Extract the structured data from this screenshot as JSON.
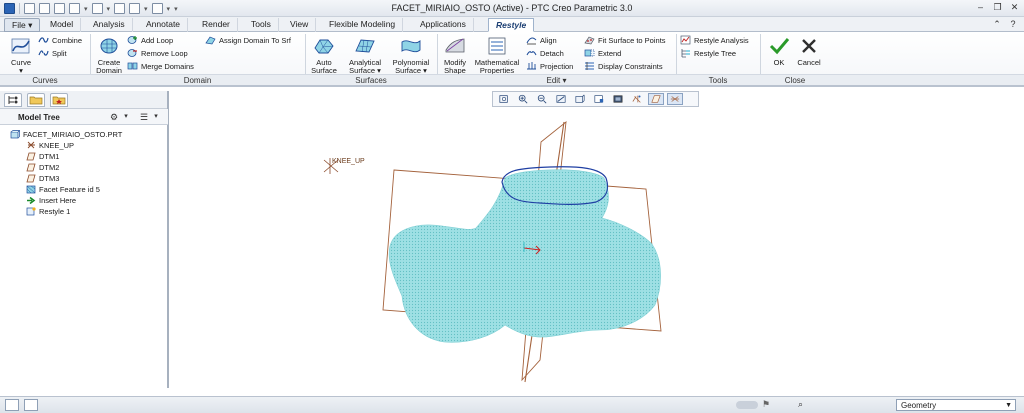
{
  "window": {
    "title": "FACET_MIRIAIO_OSTO (Active) - PTC Creo Parametric 3.0"
  },
  "tabs": [
    {
      "label": "File",
      "dropdown": "▾"
    },
    {
      "label": "Model"
    },
    {
      "label": "Analysis"
    },
    {
      "label": "Annotate"
    },
    {
      "label": "Render"
    },
    {
      "label": "Tools"
    },
    {
      "label": "View"
    },
    {
      "label": "Flexible Modeling"
    },
    {
      "label": "Applications"
    },
    {
      "label": "Restyle"
    }
  ],
  "ribbon": {
    "curves": {
      "curve": {
        "label": "Curve",
        "dropdown": "▾"
      },
      "combine": "Combine",
      "split": "Split",
      "group_label": "Curves"
    },
    "domain": {
      "create_domain": {
        "line1": "Create",
        "line2": "Domain"
      },
      "add_loop": "Add Loop",
      "remove_loop": "Remove Loop",
      "merge_domains": "Merge Domains",
      "assign_domain": "Assign Domain To Srf",
      "group_label": "Domain"
    },
    "surfaces": {
      "auto_surface": {
        "line1": "Auto",
        "line2": "Surface"
      },
      "analytical_surface": {
        "line1": "Analytical",
        "line2": "Surface ▾"
      },
      "polynomial_surface": {
        "line1": "Polynomial",
        "line2": "Surface ▾"
      },
      "group_label": "Surfaces"
    },
    "edit": {
      "modify_shape": {
        "line1": "Modify",
        "line2": "Shape"
      },
      "math_props": {
        "line1": "Mathematical",
        "line2": "Properties"
      },
      "align": "Align",
      "detach": "Detach",
      "projection": "Projection",
      "fit_surface": "Fit Surface to Points",
      "extend": "Extend",
      "display_constraints": "Display Constraints",
      "group_label": "Edit ▾"
    },
    "tools": {
      "restyle_analysis": "Restyle Analysis",
      "restyle_tree": "Restyle Tree",
      "group_label": "Tools"
    },
    "close": {
      "ok": "OK",
      "cancel": "Cancel",
      "group_label": "Close"
    }
  },
  "model_tree": {
    "title": "Model Tree",
    "items": [
      {
        "label": "FACET_MIRIAIO_OSTO.PRT",
        "icon": "part-icon"
      },
      {
        "label": "KNEE_UP",
        "icon": "csys-icon"
      },
      {
        "label": "DTM1",
        "icon": "datum-plane-icon"
      },
      {
        "label": "DTM2",
        "icon": "datum-plane-icon"
      },
      {
        "label": "DTM3",
        "icon": "datum-plane-icon"
      },
      {
        "label": "Facet Feature id 5",
        "icon": "facet-icon"
      },
      {
        "label": "Insert Here",
        "icon": "insert-arrow-icon"
      },
      {
        "label": "Restyle 1",
        "icon": "restyle-icon"
      }
    ]
  },
  "graphics": {
    "csys_label": "KNEE_UP"
  },
  "statusbar": {
    "filter_value": "Geometry"
  },
  "colors": {
    "ribbon_accent": "#2b64b5",
    "facet_fill": "#8ed9dc",
    "datum_plane": "#a4623c",
    "domain_outline": "#1f3fa3"
  }
}
